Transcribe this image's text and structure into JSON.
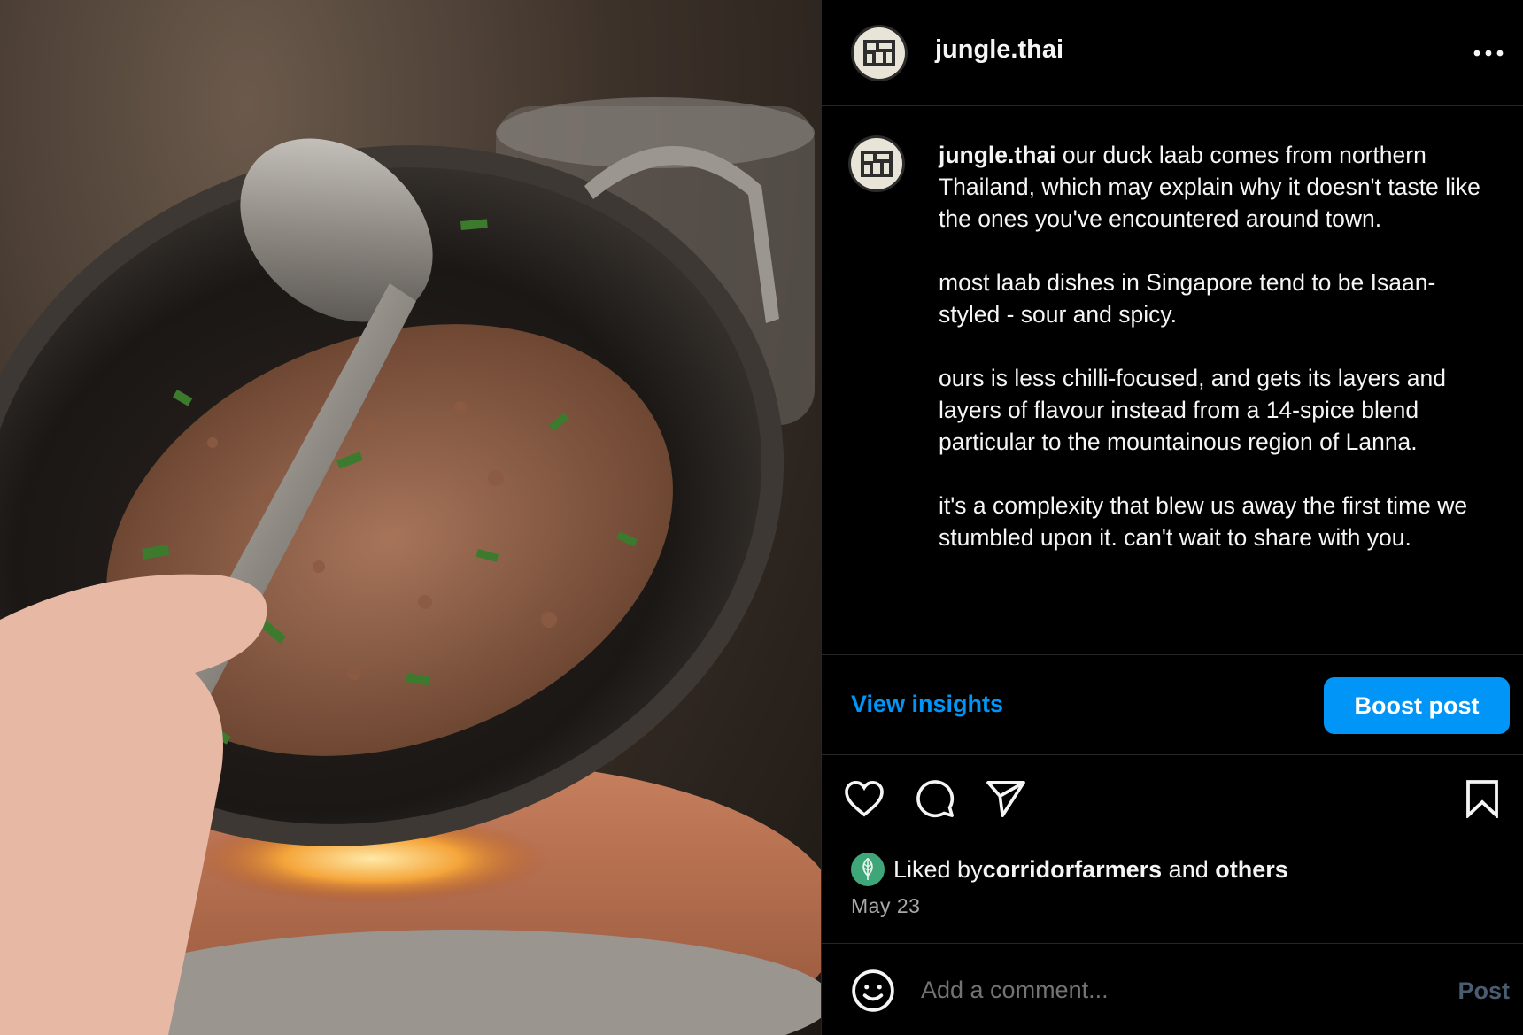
{
  "header": {
    "username": "jungle.thai",
    "more_icon": "more-horizontal-icon"
  },
  "caption": {
    "username": "jungle.thai",
    "text": " our duck laab comes from northern Thailand, which may explain why it doesn't taste like the ones you've encountered around town.\n\nmost laab dishes in Singapore tend to be Isaan-styled - sour and spicy.\n\nours is less chilli-focused, and gets its layers and layers of flavour instead from a 14-spice blend particular to the mountainous region of Lanna.\n\nit's a complexity that blew us away the first time we stumbled upon it. can't wait to share with you."
  },
  "insights": {
    "view_label": "View insights",
    "boost_label": "Boost post"
  },
  "actions": {
    "like_icon": "heart-icon",
    "comment_icon": "comment-icon",
    "share_icon": "send-icon",
    "save_icon": "bookmark-icon"
  },
  "likes": {
    "prefix": "Liked by ",
    "user": "corridorfarmers",
    "middle": " and ",
    "others": "others"
  },
  "date": "May 23",
  "comment": {
    "placeholder": "Add a comment...",
    "post_label": "Post"
  },
  "colors": {
    "accent": "#0095f6",
    "background": "#000000",
    "text": "#f5f5f5",
    "muted": "#a8a8a8",
    "divider": "#262626"
  }
}
